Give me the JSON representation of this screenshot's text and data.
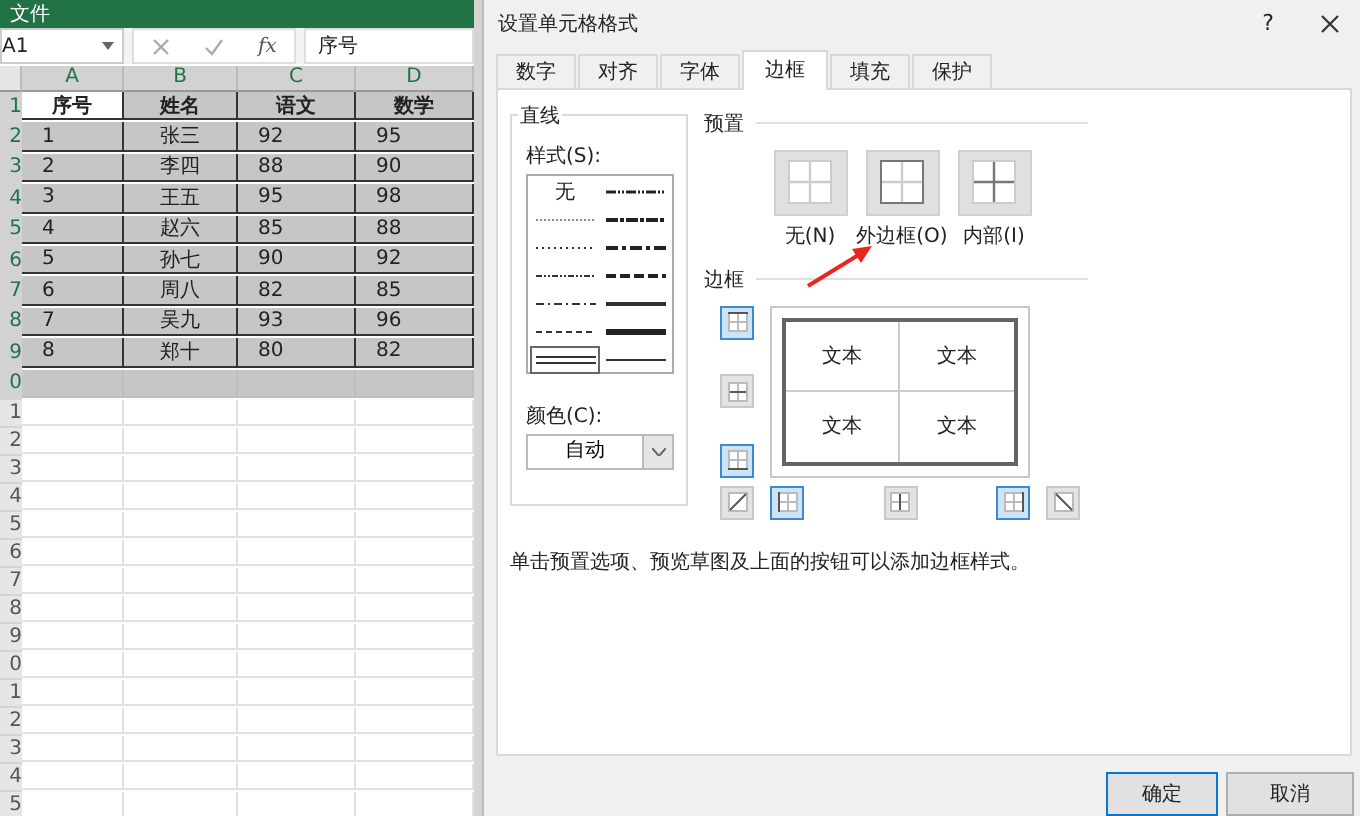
{
  "sheet": {
    "menu": "文件",
    "name_box": "A1",
    "formula_label": "fx",
    "formula": "序号",
    "columns": [
      "A",
      "B",
      "C",
      "D"
    ],
    "rows": [
      {
        "label": "1",
        "kind": "header",
        "selected": true,
        "active": true,
        "cells": [
          "序号",
          "姓名",
          "语文",
          "数学"
        ]
      },
      {
        "label": "2",
        "kind": "data",
        "selected": true,
        "active": false,
        "cells": [
          "1",
          "张三",
          "92",
          "95"
        ]
      },
      {
        "label": "3",
        "kind": "data",
        "selected": true,
        "active": false,
        "cells": [
          "2",
          "李四",
          "88",
          "90"
        ]
      },
      {
        "label": "4",
        "kind": "data",
        "selected": true,
        "active": false,
        "cells": [
          "3",
          "王五",
          "95",
          "98"
        ]
      },
      {
        "label": "5",
        "kind": "data",
        "selected": true,
        "active": false,
        "cells": [
          "4",
          "赵六",
          "85",
          "88"
        ]
      },
      {
        "label": "6",
        "kind": "data",
        "selected": true,
        "active": false,
        "cells": [
          "5",
          "孙七",
          "90",
          "92"
        ]
      },
      {
        "label": "7",
        "kind": "data",
        "selected": true,
        "active": false,
        "cells": [
          "6",
          "周八",
          "82",
          "85"
        ]
      },
      {
        "label": "8",
        "kind": "data",
        "selected": true,
        "active": false,
        "cells": [
          "7",
          "吴九",
          "93",
          "96"
        ]
      },
      {
        "label": "9",
        "kind": "data",
        "selected": true,
        "active": false,
        "cells": [
          "8",
          "郑十",
          "80",
          "82"
        ]
      },
      {
        "label": "0",
        "kind": "empty",
        "selected": true,
        "active": false
      },
      {
        "label": "1",
        "kind": "empty",
        "selected": false,
        "active": false
      },
      {
        "label": "2",
        "kind": "empty",
        "selected": false,
        "active": false
      },
      {
        "label": "3",
        "kind": "empty",
        "selected": false,
        "active": false
      },
      {
        "label": "4",
        "kind": "empty",
        "selected": false,
        "active": false
      },
      {
        "label": "5",
        "kind": "empty",
        "selected": false,
        "active": false
      },
      {
        "label": "6",
        "kind": "empty",
        "selected": false,
        "active": false
      },
      {
        "label": "7",
        "kind": "empty",
        "selected": false,
        "active": false
      },
      {
        "label": "8",
        "kind": "empty",
        "selected": false,
        "active": false
      },
      {
        "label": "9",
        "kind": "empty",
        "selected": false,
        "active": false
      },
      {
        "label": "0",
        "kind": "empty",
        "selected": false,
        "active": false
      },
      {
        "label": "1",
        "kind": "empty",
        "selected": false,
        "active": false
      },
      {
        "label": "2",
        "kind": "empty",
        "selected": false,
        "active": false
      },
      {
        "label": "3",
        "kind": "empty",
        "selected": false,
        "active": false
      },
      {
        "label": "4",
        "kind": "empty",
        "selected": false,
        "active": false
      },
      {
        "label": "5",
        "kind": "empty",
        "selected": false,
        "active": false
      }
    ]
  },
  "dialog": {
    "title": "设置单元格格式",
    "help": "?",
    "tabs": [
      {
        "label": "数字",
        "selected": false
      },
      {
        "label": "对齐",
        "selected": false
      },
      {
        "label": "字体",
        "selected": false
      },
      {
        "label": "边框",
        "selected": true
      },
      {
        "label": "填充",
        "selected": false
      },
      {
        "label": "保护",
        "selected": false
      }
    ],
    "line": {
      "title": "直线",
      "style_label": "样式(S):",
      "color_label": "颜色(C):",
      "color_value": "自动",
      "styles": [
        {
          "kind": "none",
          "label": "无",
          "selected": false
        },
        {
          "kind": "hair",
          "selected": false
        },
        {
          "kind": "dotted",
          "selected": false
        },
        {
          "kind": "dash-dot-dot",
          "selected": false
        },
        {
          "kind": "dash-dot",
          "selected": false
        },
        {
          "kind": "dashed",
          "selected": false
        },
        {
          "kind": "double",
          "selected": true
        },
        {
          "kind": "medium-dash-dot-dot",
          "selected": false
        },
        {
          "kind": "slant-dash-dot",
          "selected": false
        },
        {
          "kind": "medium-dash-dot",
          "selected": false
        },
        {
          "kind": "medium-dashed",
          "selected": false
        },
        {
          "kind": "medium",
          "selected": false
        },
        {
          "kind": "thick",
          "selected": false
        },
        {
          "kind": "thin",
          "selected": false
        }
      ]
    },
    "presets": {
      "title": "预置",
      "items": [
        {
          "kind": "none",
          "label": "无(N)"
        },
        {
          "kind": "outline",
          "label": "外边框(O)"
        },
        {
          "kind": "inside",
          "label": "内部(I)"
        }
      ]
    },
    "borders": {
      "title": "边框",
      "preview_text": [
        "文本",
        "文本",
        "文本",
        "文本"
      ],
      "toggles": [
        {
          "kind": "top",
          "pressed": true
        },
        {
          "kind": "middle-horizontal",
          "pressed": false
        },
        {
          "kind": "bottom",
          "pressed": true
        },
        {
          "kind": "diagonal-up",
          "pressed": false
        },
        {
          "kind": "left",
          "pressed": true
        },
        {
          "kind": "middle-vertical",
          "pressed": false
        },
        {
          "kind": "right",
          "pressed": true
        },
        {
          "kind": "diagonal-down",
          "pressed": false
        }
      ]
    },
    "hint": "单击预置选项、预览草图及上面的按钮可以添加边框样式。",
    "buttons": [
      {
        "label": "确定",
        "kind": "primary"
      },
      {
        "label": "取消",
        "kind": "secondary"
      }
    ]
  }
}
